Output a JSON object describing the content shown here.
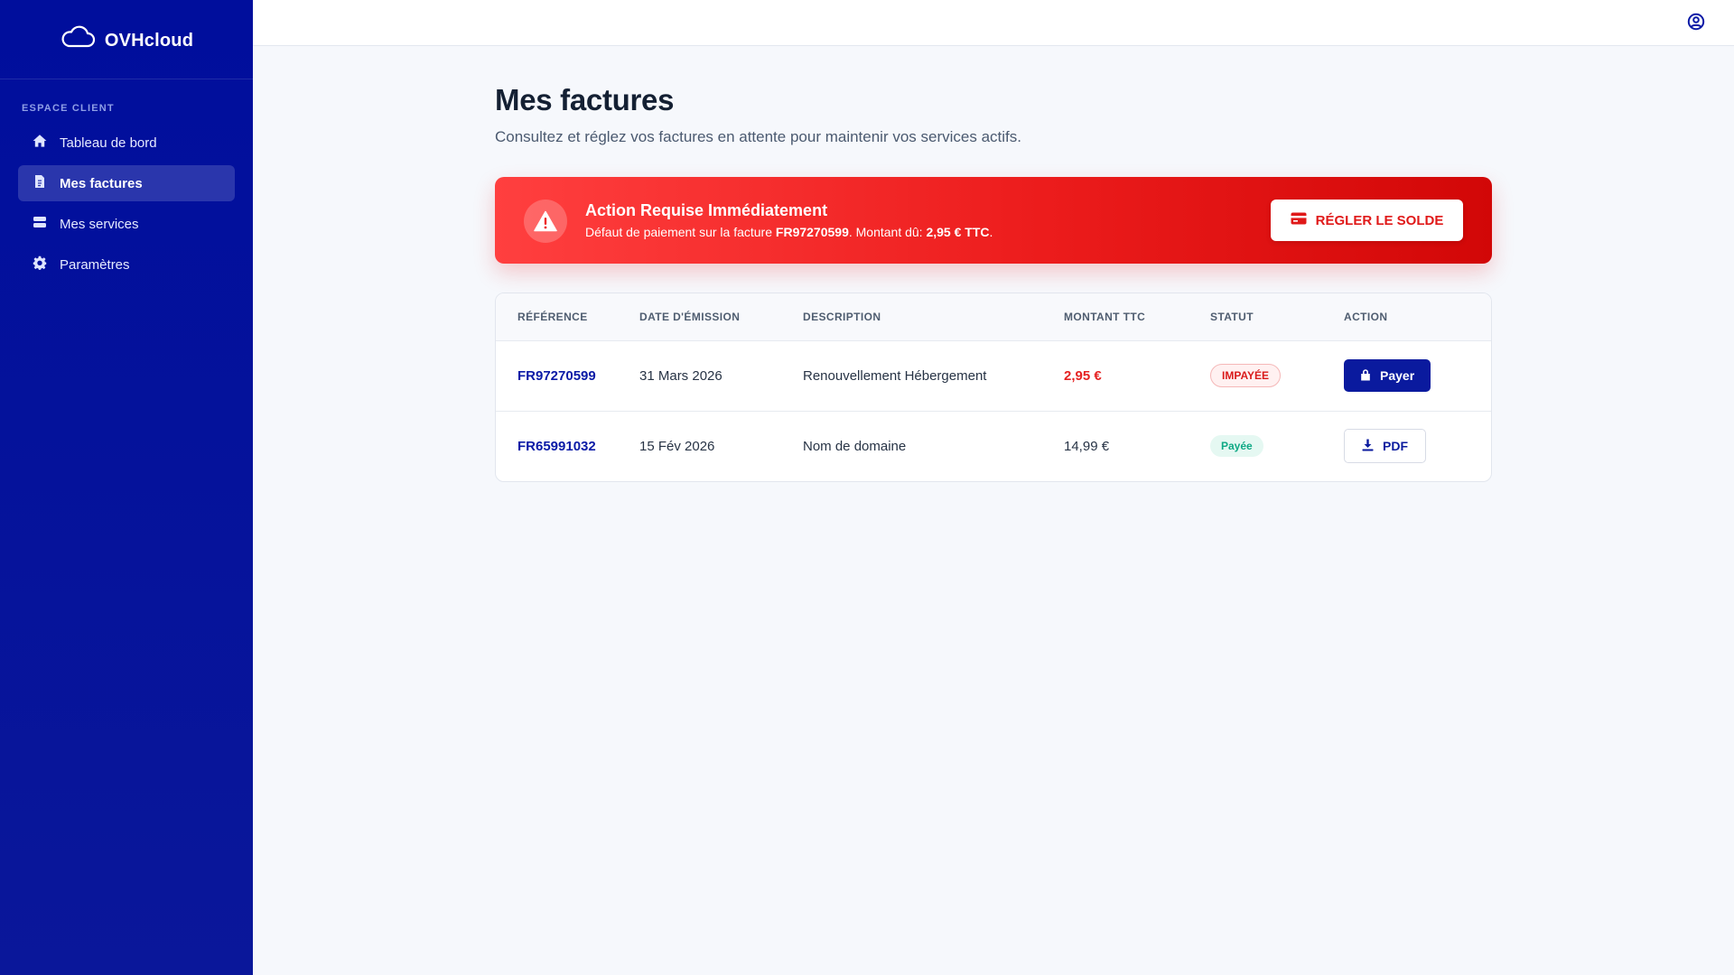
{
  "brand": {
    "name": "OVHcloud",
    "logo_icon": "cloud-icon"
  },
  "sidebar": {
    "section_label": "ESPACE CLIENT",
    "items": [
      {
        "label": "Tableau de bord",
        "icon": "home-icon"
      },
      {
        "label": "Mes factures",
        "icon": "invoice-icon",
        "active": true
      },
      {
        "label": "Mes services",
        "icon": "server-icon"
      },
      {
        "label": "Paramètres",
        "icon": "gear-icon"
      }
    ]
  },
  "topbar": {
    "user_icon": "user-circle-icon"
  },
  "page": {
    "title": "Mes factures",
    "subtitle": "Consultez et réglez vos factures en attente pour maintenir vos services actifs."
  },
  "alert": {
    "title": "Action Requise Immédiatement",
    "text_prefix": "Défaut de paiement sur la facture ",
    "invoice_ref": "FR97270599",
    "text_middle": ". Montant dû: ",
    "amount": "2,95 € TTC",
    "text_suffix": ".",
    "button_label": "RÉGLER LE SOLDE",
    "colors": {
      "start": "#ff3f3f",
      "end": "#d20707"
    }
  },
  "table": {
    "headers": {
      "reference": "RÉFÉRENCE",
      "date": "DATE D'ÉMISSION",
      "description": "DESCRIPTION",
      "amount": "MONTANT TTC",
      "status": "STATUT",
      "action": "ACTION"
    },
    "rows": [
      {
        "reference": "FR97270599",
        "date": "31 Mars 2026",
        "description": "Renouvellement Hébergement",
        "amount": "2,95 €",
        "status": "IMPAYÉE",
        "action_label": "Payer"
      },
      {
        "reference": "FR65991032",
        "date": "15 Fév 2026",
        "description": "Nom de domaine",
        "amount": "14,99 €",
        "status": "Payée",
        "action_label": "PDF"
      }
    ]
  },
  "colors": {
    "sidebar": "#000e9c",
    "accent": "#0a1a9e",
    "danger": "#e52222",
    "success": "#0fa985"
  }
}
